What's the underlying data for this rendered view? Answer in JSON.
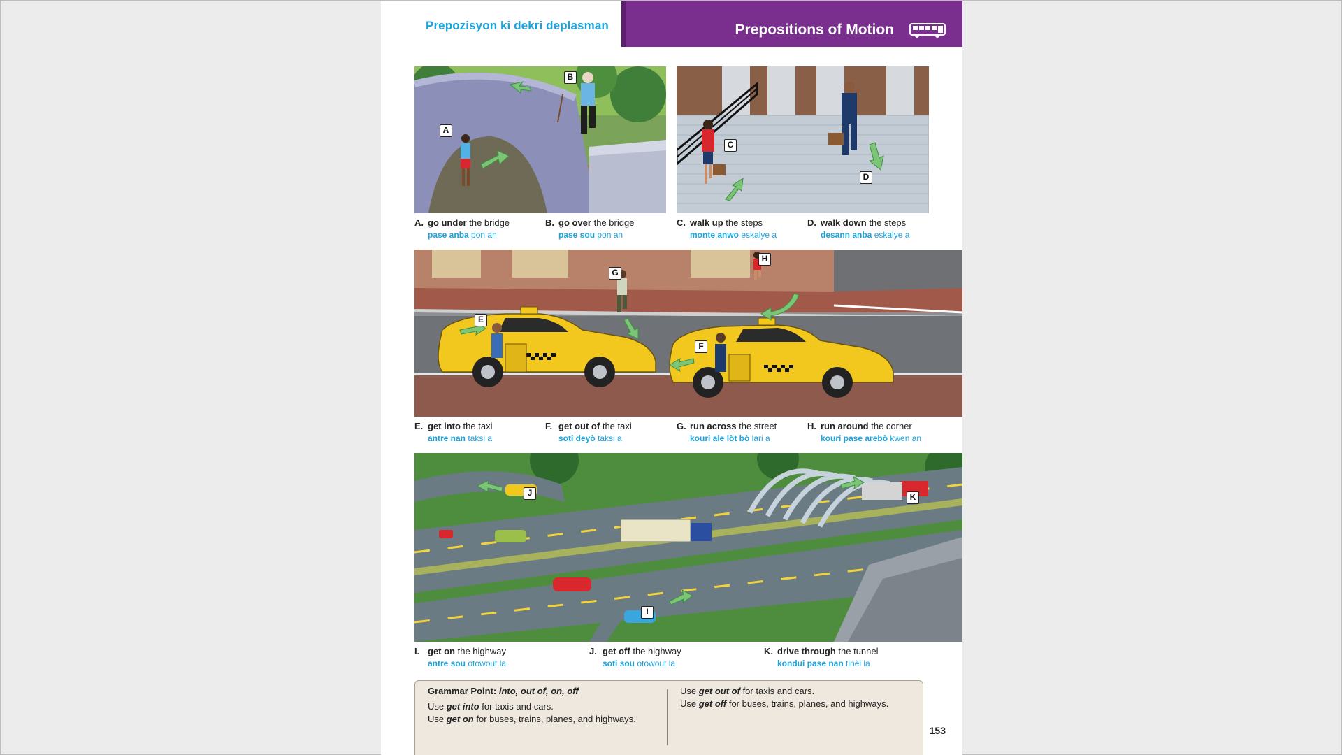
{
  "header": {
    "subtitle": "Prepozisyon ki dekri deplasman",
    "title": "Prepositions of Motion",
    "icon": "bus-icon"
  },
  "tags": [
    "A",
    "B",
    "C",
    "D",
    "E",
    "F",
    "G",
    "H",
    "I",
    "J",
    "K"
  ],
  "captions": [
    {
      "letter": "A.",
      "bold": "go under",
      "rest": " the bridge",
      "tbold": "pase anba",
      "trest": " pon an"
    },
    {
      "letter": "B.",
      "bold": "go over",
      "rest": " the bridge",
      "tbold": "pase sou",
      "trest": " pon an"
    },
    {
      "letter": "C.",
      "bold": "walk up",
      "rest": " the steps",
      "tbold": "monte anwo",
      "trest": " eskalye a"
    },
    {
      "letter": "D.",
      "bold": "walk down",
      "rest": " the steps",
      "tbold": "desann anba",
      "trest": " eskalye a"
    },
    {
      "letter": "E.",
      "bold": "get into",
      "rest": " the taxi",
      "tbold": "antre nan",
      "trest": " taksi a"
    },
    {
      "letter": "F.",
      "bold": "get out of",
      "rest": " the taxi",
      "tbold": "soti deyò",
      "trest": " taksi a"
    },
    {
      "letter": "G.",
      "bold": "run across",
      "rest": " the street",
      "tbold": "kouri ale lòt bò",
      "trest": " lari a"
    },
    {
      "letter": "H.",
      "bold": "run around",
      "rest": " the corner",
      "tbold": "kouri pase arebò",
      "trest": " kwen an"
    },
    {
      "letter": "I.",
      "bold": "get on",
      "rest": " the highway",
      "tbold": "antre sou",
      "trest": " otowout la"
    },
    {
      "letter": "J.",
      "bold": "get off",
      "rest": " the highway",
      "tbold": "soti sou",
      "trest": " otowout la"
    },
    {
      "letter": "K.",
      "bold": "drive through",
      "rest": " the tunnel",
      "tbold": "kondui pase nan",
      "trest": " tinèl la"
    }
  ],
  "grammar": {
    "title": "Grammar Point: ",
    "title_italic": "into, out of, on, off",
    "left": [
      {
        "pre": "Use ",
        "em": "get into",
        "post": " for taxis and cars."
      },
      {
        "pre": "Use ",
        "em": "get on",
        "post": " for buses, trains, planes, and highways."
      }
    ],
    "right": [
      {
        "pre": "Use ",
        "em": "get out of",
        "post": " for taxis and cars."
      },
      {
        "pre": "Use ",
        "em": "get off",
        "post": " for buses, trains, planes, and highways."
      }
    ]
  },
  "page_number": "153",
  "colors": {
    "accent_blue": "#1ba3dd",
    "header_purple": "#7a2f8f",
    "arrow_green": "#7cc576",
    "taxi_yellow": "#f2c81f"
  }
}
